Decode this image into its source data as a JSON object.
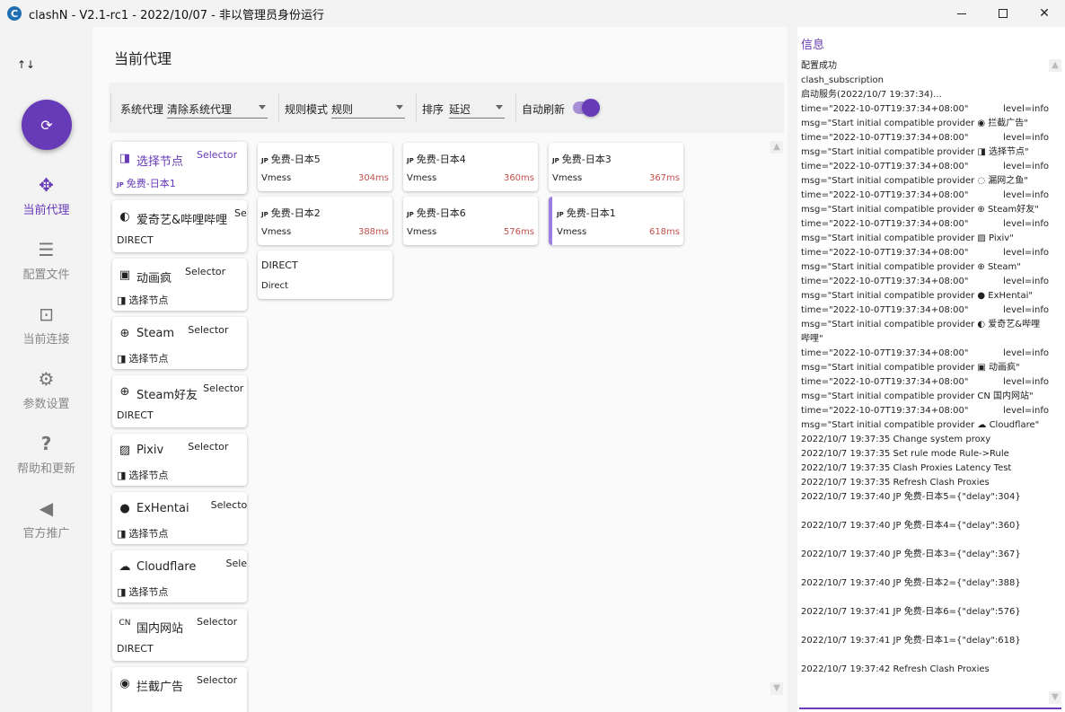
{
  "window": {
    "title": "clashN - V2.1-rc1 - 2022/10/07 - 非以管理员身份运行",
    "logo": "C"
  },
  "nav": {
    "sort_icon": "↑↓",
    "refresh_icon": "refresh-icon",
    "items": [
      {
        "label": "当前代理",
        "icon": "proxy-move-icon",
        "active": true
      },
      {
        "label": "配置文件",
        "icon": "server-stack-icon",
        "active": false
      },
      {
        "label": "当前连接",
        "icon": "connection-icon",
        "active": false
      },
      {
        "label": "参数设置",
        "icon": "gear-icon",
        "active": false
      },
      {
        "label": "帮助和更新",
        "icon": "help-icon",
        "active": false
      },
      {
        "label": "官方推广",
        "icon": "speaker-icon",
        "active": false
      }
    ]
  },
  "main": {
    "title": "当前代理",
    "toolbar": {
      "system_proxy_label": "系统代理",
      "system_proxy_value": "清除系统代理",
      "rule_mode_label": "规则模式",
      "rule_mode_value": "规则",
      "sort_label": "排序",
      "sort_value": "延迟",
      "auto_refresh_label": "自动刷新",
      "auto_refresh_on": true
    },
    "groups": [
      {
        "icon": "◨",
        "name": "选择节点",
        "type": "Selector",
        "now_prefix": "JP",
        "now": "免费-日本1",
        "active": true
      },
      {
        "icon": "◐",
        "name": "爱奇艺&哔哩哔哩",
        "type": "Se",
        "now_prefix": "",
        "now": "DIRECT",
        "active": false
      },
      {
        "icon": "▣",
        "name": "动画疯",
        "type": "Selector",
        "now_prefix": "◨",
        "now": "选择节点",
        "active": false
      },
      {
        "icon": "⊕",
        "name": "Steam",
        "type": "Selector",
        "now_prefix": "◨",
        "now": "选择节点",
        "active": false
      },
      {
        "icon": "⊕",
        "name": "Steam好友",
        "type": "Selector",
        "now_prefix": "",
        "now": "DIRECT",
        "active": false
      },
      {
        "icon": "▨",
        "name": "Pixiv",
        "type": "Selector",
        "now_prefix": "◨",
        "now": "选择节点",
        "active": false
      },
      {
        "icon": "●",
        "name": "ExHentai",
        "type": "Selector",
        "now_prefix": "◨",
        "now": "选择节点",
        "active": false
      },
      {
        "icon": "☁",
        "name": "Cloudflare",
        "type": "Selector",
        "now_prefix": "◨",
        "now": "选择节点",
        "active": false
      },
      {
        "icon": "CN",
        "name": "国内网站",
        "type": "Selector",
        "now_prefix": "",
        "now": "DIRECT",
        "active": false
      },
      {
        "icon": "◉",
        "name": "拦截广告",
        "type": "Selector",
        "now_prefix": "",
        "now": "",
        "active": false
      }
    ],
    "proxies": [
      {
        "prefix": "JP",
        "name": "免费-日本5",
        "type": "Vmess",
        "delay": "304ms",
        "active": false
      },
      {
        "prefix": "JP",
        "name": "免费-日本4",
        "type": "Vmess",
        "delay": "360ms",
        "active": false
      },
      {
        "prefix": "JP",
        "name": "免费-日本3",
        "type": "Vmess",
        "delay": "367ms",
        "active": false
      },
      {
        "prefix": "JP",
        "name": "免费-日本2",
        "type": "Vmess",
        "delay": "388ms",
        "active": false
      },
      {
        "prefix": "JP",
        "name": "免费-日本6",
        "type": "Vmess",
        "delay": "576ms",
        "active": false
      },
      {
        "prefix": "JP",
        "name": "免费-日本1",
        "type": "Vmess",
        "delay": "618ms",
        "active": true
      },
      {
        "prefix": "",
        "name": "DIRECT",
        "type": "Direct",
        "delay": "",
        "active": false
      }
    ]
  },
  "log": {
    "title": "信息",
    "lines": [
      {
        "l": "配置成功",
        "r": ""
      },
      {
        "l": "clash_subscription",
        "r": ""
      },
      {
        "l": "启动服务(2022/10/7 19:37:34)...",
        "r": ""
      },
      {
        "l": "time=\"2022-10-07T19:37:34+08:00\"",
        "r": "level=info"
      },
      {
        "l": "msg=\"Start initial compatible provider ◉ 拦截广告\"",
        "r": ""
      },
      {
        "l": "time=\"2022-10-07T19:37:34+08:00\"",
        "r": "level=info"
      },
      {
        "l": "msg=\"Start initial compatible provider ◨ 选择节点\"",
        "r": ""
      },
      {
        "l": "time=\"2022-10-07T19:37:34+08:00\"",
        "r": "level=info"
      },
      {
        "l": "msg=\"Start initial compatible provider ◌ 漏网之鱼\"",
        "r": ""
      },
      {
        "l": "time=\"2022-10-07T19:37:34+08:00\"",
        "r": "level=info"
      },
      {
        "l": "msg=\"Start initial compatible provider ⊕ Steam好友\"",
        "r": ""
      },
      {
        "l": "time=\"2022-10-07T19:37:34+08:00\"",
        "r": "level=info"
      },
      {
        "l": "msg=\"Start initial compatible provider ▨ Pixiv\"",
        "r": ""
      },
      {
        "l": "time=\"2022-10-07T19:37:34+08:00\"",
        "r": "level=info"
      },
      {
        "l": "msg=\"Start initial compatible provider ⊕ Steam\"",
        "r": ""
      },
      {
        "l": "time=\"2022-10-07T19:37:34+08:00\"",
        "r": "level=info"
      },
      {
        "l": "msg=\"Start initial compatible provider ● ExHentai\"",
        "r": ""
      },
      {
        "l": "time=\"2022-10-07T19:37:34+08:00\"",
        "r": "level=info"
      },
      {
        "l": "msg=\"Start initial compatible provider ◐ 爱奇艺&哔哩",
        "r": ""
      },
      {
        "l": "哔哩\"",
        "r": ""
      },
      {
        "l": "time=\"2022-10-07T19:37:34+08:00\"",
        "r": "level=info"
      },
      {
        "l": "msg=\"Start initial compatible provider ▣ 动画疯\"",
        "r": ""
      },
      {
        "l": "time=\"2022-10-07T19:37:34+08:00\"",
        "r": "level=info"
      },
      {
        "l": "msg=\"Start initial compatible provider CN 国内网站\"",
        "r": ""
      },
      {
        "l": "time=\"2022-10-07T19:37:34+08:00\"",
        "r": "level=info"
      },
      {
        "l": "msg=\"Start initial compatible provider ☁ Cloudflare\"",
        "r": ""
      },
      {
        "l": "2022/10/7 19:37:35 Change system proxy",
        "r": ""
      },
      {
        "l": "2022/10/7 19:37:35 Set rule mode Rule->Rule",
        "r": ""
      },
      {
        "l": "2022/10/7 19:37:35 Clash Proxies Latency Test",
        "r": ""
      },
      {
        "l": "2022/10/7 19:37:35 Refresh Clash Proxies",
        "r": ""
      },
      {
        "l": "2022/10/7 19:37:40 JP 免费-日本5={\"delay\":304}",
        "r": ""
      },
      {
        "l": "",
        "r": ""
      },
      {
        "l": "2022/10/7 19:37:40 JP 免费-日本4={\"delay\":360}",
        "r": ""
      },
      {
        "l": "",
        "r": ""
      },
      {
        "l": "2022/10/7 19:37:40 JP 免费-日本3={\"delay\":367}",
        "r": ""
      },
      {
        "l": "",
        "r": ""
      },
      {
        "l": "2022/10/7 19:37:40 JP 免费-日本2={\"delay\":388}",
        "r": ""
      },
      {
        "l": "",
        "r": ""
      },
      {
        "l": "2022/10/7 19:37:41 JP 免费-日本6={\"delay\":576}",
        "r": ""
      },
      {
        "l": "",
        "r": ""
      },
      {
        "l": "2022/10/7 19:37:41 JP 免费-日本1={\"delay\":618}",
        "r": ""
      },
      {
        "l": "",
        "r": ""
      },
      {
        "l": "2022/10/7 19:37:42 Refresh Clash Proxies",
        "r": ""
      }
    ]
  }
}
